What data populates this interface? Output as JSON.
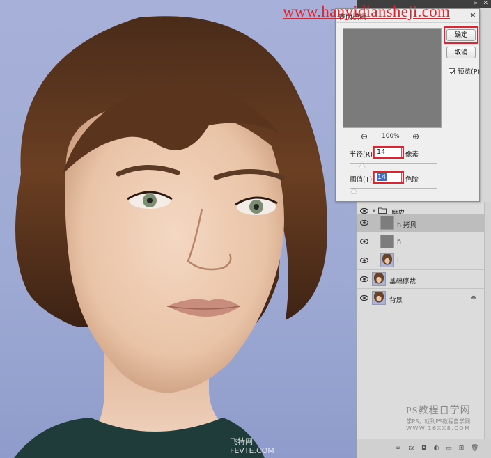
{
  "site_url": "www.hanyidiansheji.com",
  "photo": {
    "watermark_top": "飞特网",
    "watermark_bottom": "FEVTE.COM"
  },
  "dialog": {
    "title": "表面模糊",
    "close_icon": "close-icon",
    "ok_label": "确定",
    "cancel_label": "取消",
    "preview_label": "预览(P)",
    "preview_checked": true,
    "zoom_level": "100%",
    "radius": {
      "label": "半径(R):",
      "value": "14",
      "unit": "像素",
      "slider": 0.14
    },
    "threshold": {
      "label": "阈值(T):",
      "value": "14",
      "unit": "色阶",
      "slider": 0.05
    },
    "highlight_color": "#e0232f"
  },
  "layers": [
    {
      "name": "磨皮",
      "type": "group",
      "visible": true
    },
    {
      "name": "h 拷贝",
      "type": "gray",
      "visible": true,
      "active": true
    },
    {
      "name": "h",
      "type": "gray",
      "visible": true
    },
    {
      "name": "l",
      "type": "photo",
      "visible": true
    },
    {
      "name": "基础修裁",
      "type": "photo",
      "visible": true
    },
    {
      "name": "背景",
      "type": "photo",
      "visible": true,
      "locked": true
    }
  ],
  "panel_watermark": {
    "line1": "PS教程自学网",
    "line2": "学PS，就到PS教程自学网",
    "line3": "WWW.16XX8.COM"
  },
  "footer_icons": [
    "link-icon",
    "fx-icon",
    "mask-icon",
    "adjustment-icon",
    "group-icon",
    "new-layer-icon",
    "trash-icon"
  ]
}
